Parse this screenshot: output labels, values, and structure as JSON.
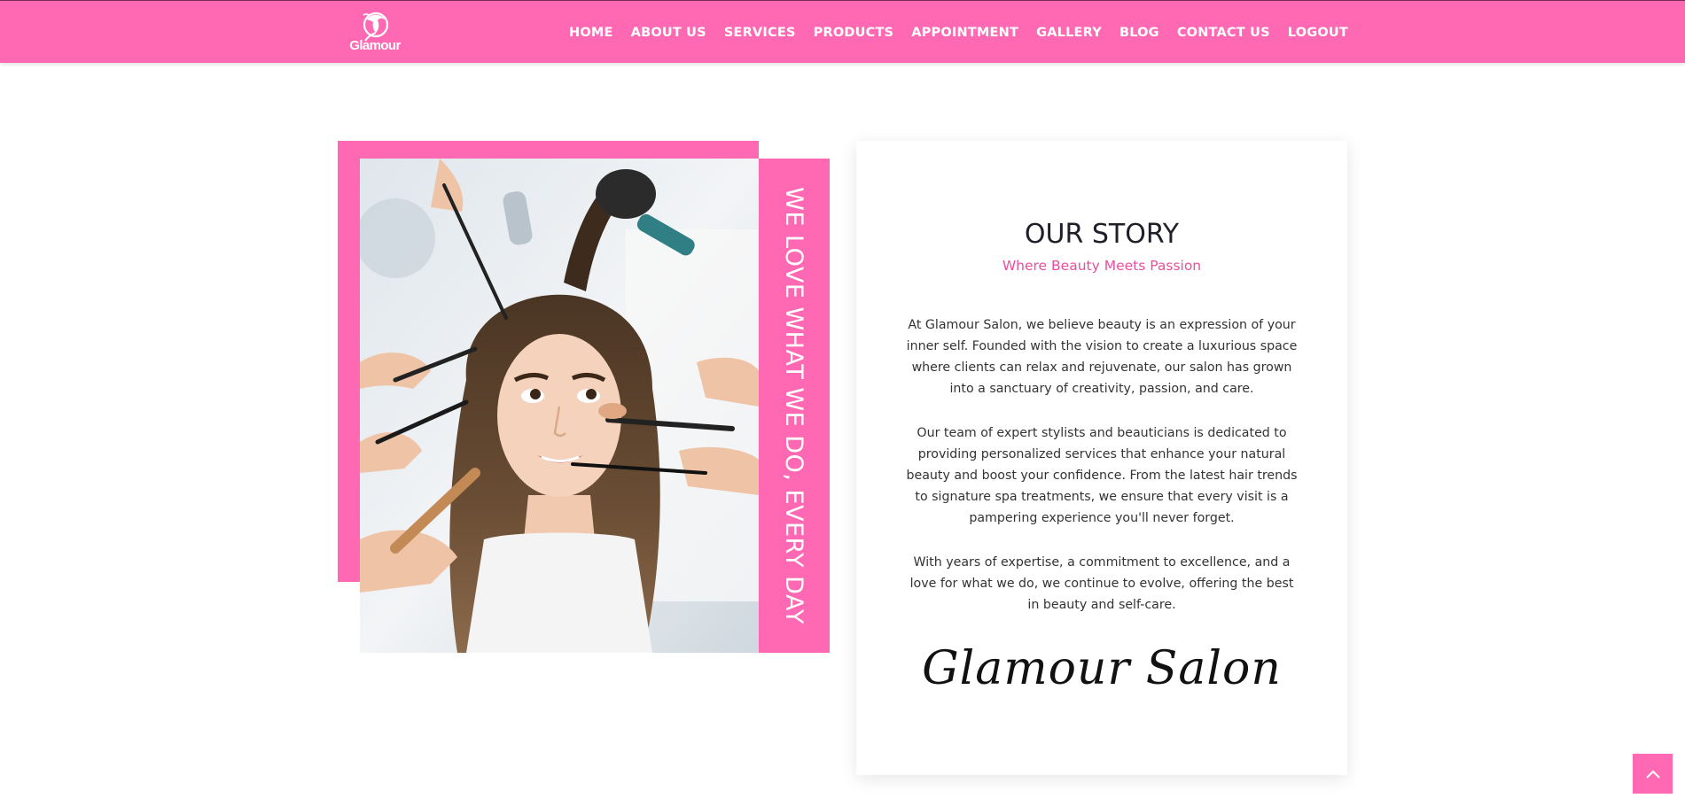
{
  "brand": {
    "name": "Glamour",
    "logo_icon": "woman-silhouette-icon",
    "color": "#ff69b4"
  },
  "nav": {
    "items": [
      {
        "label": "HOME"
      },
      {
        "label": "ABOUT US"
      },
      {
        "label": "SERVICES"
      },
      {
        "label": "PRODUCTS"
      },
      {
        "label": "APPOINTMENT"
      },
      {
        "label": "GALLERY"
      },
      {
        "label": "BLOG"
      },
      {
        "label": "CONTACT US"
      },
      {
        "label": "LOGOUT"
      }
    ]
  },
  "hero": {
    "vertical_text": "WE LOVE WHAT WE DO, EVERY DAY"
  },
  "story": {
    "title": "OUR STORY",
    "subtitle": "Where Beauty Meets Passion",
    "paragraphs": [
      "At Glamour Salon, we believe beauty is an expression of your inner self. Founded with the vision to create a luxurious space where clients can relax and rejuvenate, our salon has grown into a sanctuary of creativity, passion, and care.",
      "Our team of expert stylists and beauticians is dedicated to providing personalized services that enhance your natural beauty and boost your confidence. From the latest hair trends to signature spa treatments, we ensure that every visit is a pampering experience you'll never forget.",
      "With years of expertise, a commitment to excellence, and a love for what we do, we continue to evolve, offering the best in beauty and self-care."
    ],
    "signature": "Glamour Salon"
  },
  "back_to_top": {
    "icon": "chevron-up-icon"
  },
  "colors": {
    "accent": "#ff69b4",
    "subtitle": "#e94f9e",
    "text": "#333333"
  }
}
